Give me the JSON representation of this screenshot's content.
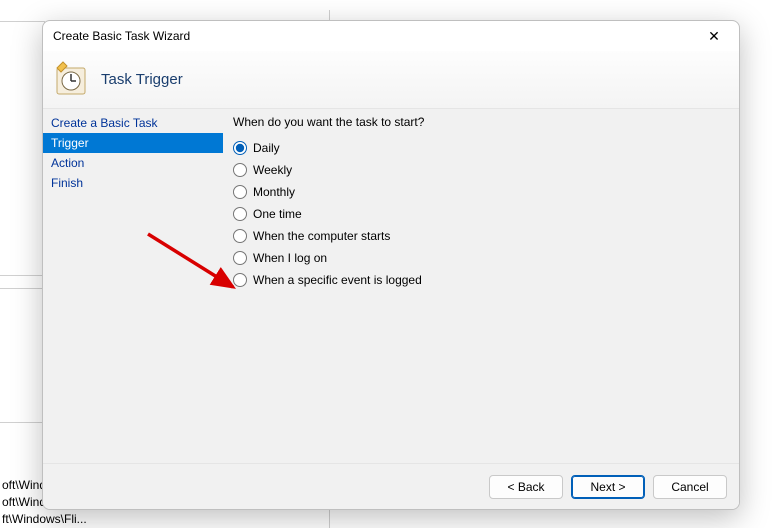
{
  "dialog": {
    "title": "Create Basic Task Wizard",
    "header": "Task Trigger",
    "close_glyph": "✕"
  },
  "nav": {
    "items": [
      {
        "label": "Create a Basic Task",
        "selected": false
      },
      {
        "label": "Trigger",
        "selected": true
      },
      {
        "label": "Action",
        "selected": false
      },
      {
        "label": "Finish",
        "selected": false
      }
    ]
  },
  "content": {
    "question": "When do you want the task to start?",
    "options": [
      {
        "label": "Daily",
        "checked": true
      },
      {
        "label": "Weekly",
        "checked": false
      },
      {
        "label": "Monthly",
        "checked": false
      },
      {
        "label": "One time",
        "checked": false
      },
      {
        "label": "When the computer starts",
        "checked": false
      },
      {
        "label": "When I log on",
        "checked": false
      },
      {
        "label": "When a specific event is logged",
        "checked": false
      }
    ]
  },
  "footer": {
    "back": "< Back",
    "next": "Next >",
    "cancel": "Cancel"
  },
  "bg": {
    "line1": "oft\\Windo...",
    "line2": "oft\\Windows\\U...",
    "line3": "ft\\Windows\\Fli..."
  }
}
